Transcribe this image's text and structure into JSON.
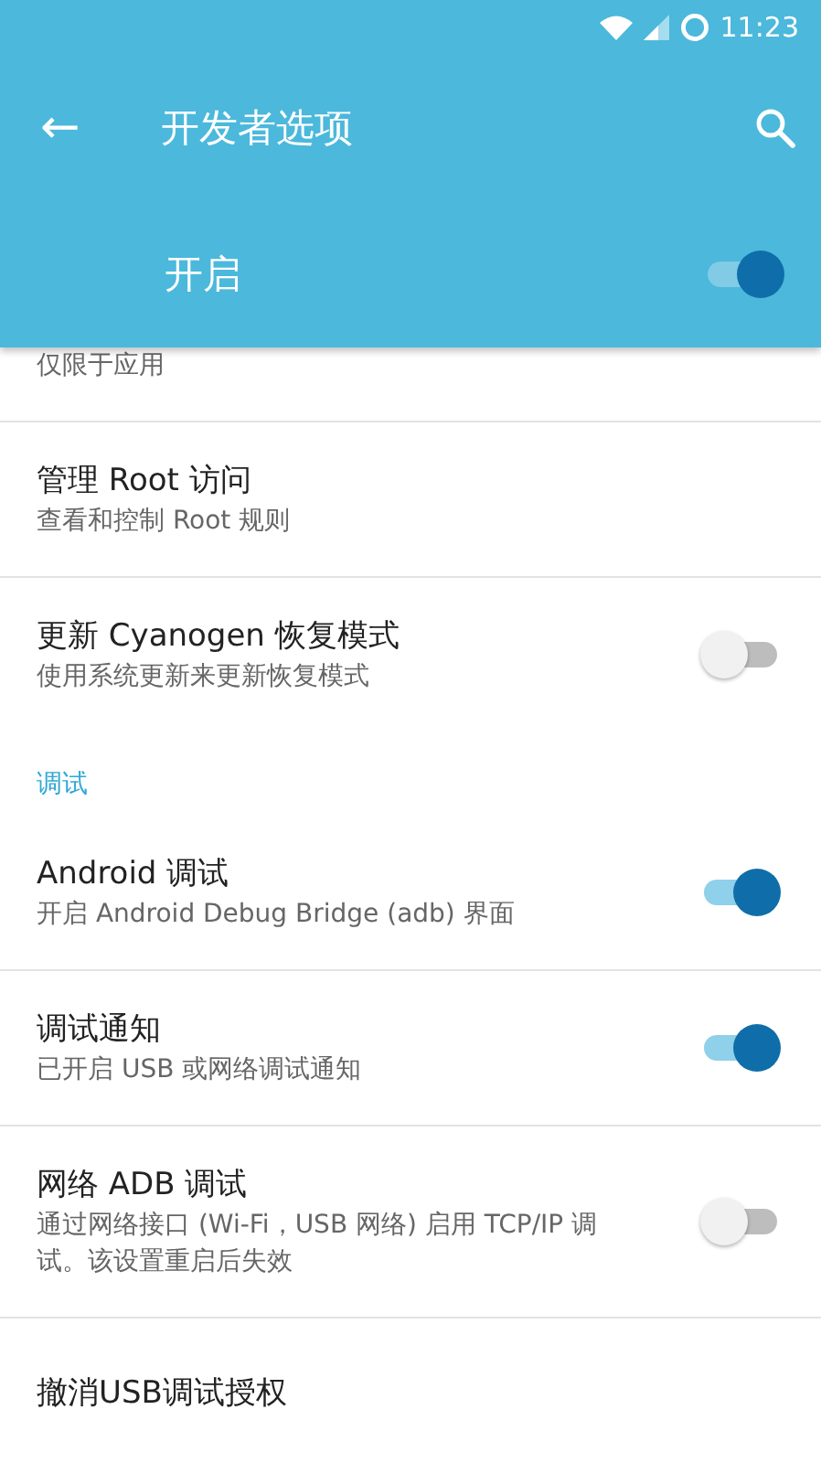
{
  "status_bar": {
    "time": "11:23"
  },
  "toolbar": {
    "back": "←",
    "title": "开发者选项"
  },
  "master_switch": {
    "label": "开启",
    "on": true
  },
  "items": [
    {
      "kind": "plain",
      "summary": "仅限于应用"
    },
    {
      "kind": "plain",
      "title": "管理 Root 访问",
      "summary": "查看和控制 Root 规则"
    },
    {
      "kind": "switch",
      "title": "更新 Cyanogen 恢复模式",
      "summary": "使用系统更新来更新恢复模式",
      "on": false
    },
    {
      "kind": "category",
      "title": "调试"
    },
    {
      "kind": "switch",
      "title": "Android 调试",
      "summary": "开启 Android Debug Bridge (adb) 界面",
      "on": true
    },
    {
      "kind": "switch",
      "title": "调试通知",
      "summary": "已开启 USB 或网络调试通知",
      "on": true
    },
    {
      "kind": "switch",
      "title": "网络 ADB 调试",
      "summary": "通过网络接口 (Wi-Fi，USB 网络) 启用 TCP/IP 调试。该设置重启后失效",
      "on": false
    },
    {
      "kind": "plain",
      "title": "撤消USB调试授权"
    }
  ]
}
